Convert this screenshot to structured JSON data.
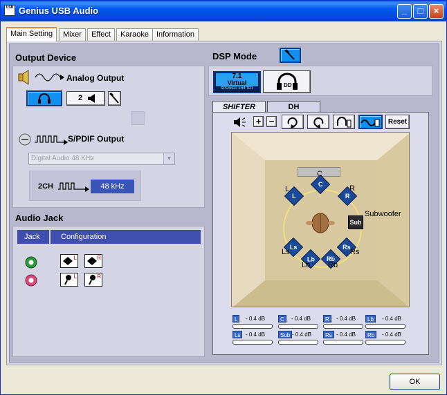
{
  "window": {
    "title": "Genius USB Audio",
    "icon_text": "USB"
  },
  "tabs": [
    {
      "label": "Main Setting"
    },
    {
      "label": "Mixer"
    },
    {
      "label": "Effect"
    },
    {
      "label": "Karaoke"
    },
    {
      "label": "Information"
    }
  ],
  "output_device": {
    "title": "Output Device",
    "analog_label": "Analog Output",
    "speaker_count": "2",
    "spdif_label": "S/PDIF Output",
    "spdif_select_value": "Digital Audio 48 KHz",
    "channel_label": "2CH",
    "rate_value": "48 kHz"
  },
  "audio_jack": {
    "title": "Audio Jack",
    "headers": [
      "Jack",
      "Configuration"
    ],
    "marks": [
      "L",
      "R",
      "L",
      "R"
    ]
  },
  "dsp": {
    "title": "DSP Mode",
    "virtual_top": "7.1",
    "virtual_mid": "Virtual",
    "virtual_bottom": "SPEAKER SHIFTER",
    "tabs": [
      "SHIFTER",
      "DH"
    ],
    "reset_label": "Reset",
    "speakers": {
      "c": "C",
      "l": "L",
      "r": "R",
      "sub": "Sub",
      "ls": "Ls",
      "rs": "Rs",
      "lb": "Lb",
      "rb": "Rb"
    },
    "speaker_labels": {
      "c": "C",
      "l": "L",
      "r": "R",
      "sub": "Subwoofer",
      "ls": "Ls",
      "rs": "Rs",
      "lb": "Lb",
      "rb": "Rb"
    },
    "levels": [
      {
        "tag": "L",
        "db": "- 0.4 dB"
      },
      {
        "tag": "C",
        "db": "- 0.4 dB"
      },
      {
        "tag": "R",
        "db": "- 0.4 dB"
      },
      {
        "tag": "Lb",
        "db": "- 0.4 dB"
      },
      {
        "tag": "Ls",
        "db": "- 0.4 dB"
      },
      {
        "tag": "Sub",
        "db": "- 0.4 dB"
      },
      {
        "tag": "Rs",
        "db": "- 0.4 dB"
      },
      {
        "tag": "Rb",
        "db": "- 0.4 dB"
      }
    ]
  },
  "footer": {
    "ok_label": "OK"
  },
  "colors": {
    "accent_blue": "#1090f0",
    "title_bar": "#0058ee",
    "panel": "#b8b8cc",
    "jack_green": "#2a9a3a",
    "jack_pink": "#d84a7a"
  }
}
